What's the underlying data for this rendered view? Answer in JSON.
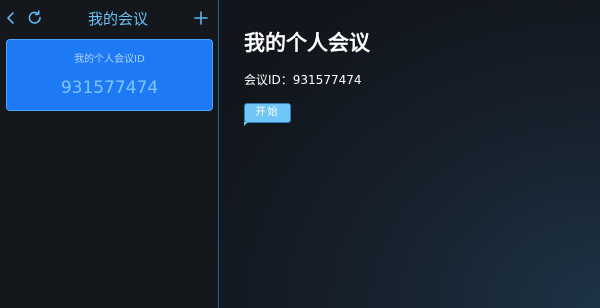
{
  "sidebar": {
    "title": "我的会议",
    "icons": {
      "back": "chevron-left-icon",
      "refresh": "refresh-icon",
      "add": "plus-icon"
    },
    "card": {
      "label": "我的个人会议ID",
      "meeting_id": "931577474"
    }
  },
  "main": {
    "title": "我的个人会议",
    "meeting_id_line": "会议ID：931577474",
    "start_label": "开始"
  },
  "colors": {
    "accent": "#1e79f5",
    "icon": "#5eb4ec",
    "button": "#6fc6f7",
    "divider": "#2e5f8a",
    "background": "#12151b"
  }
}
